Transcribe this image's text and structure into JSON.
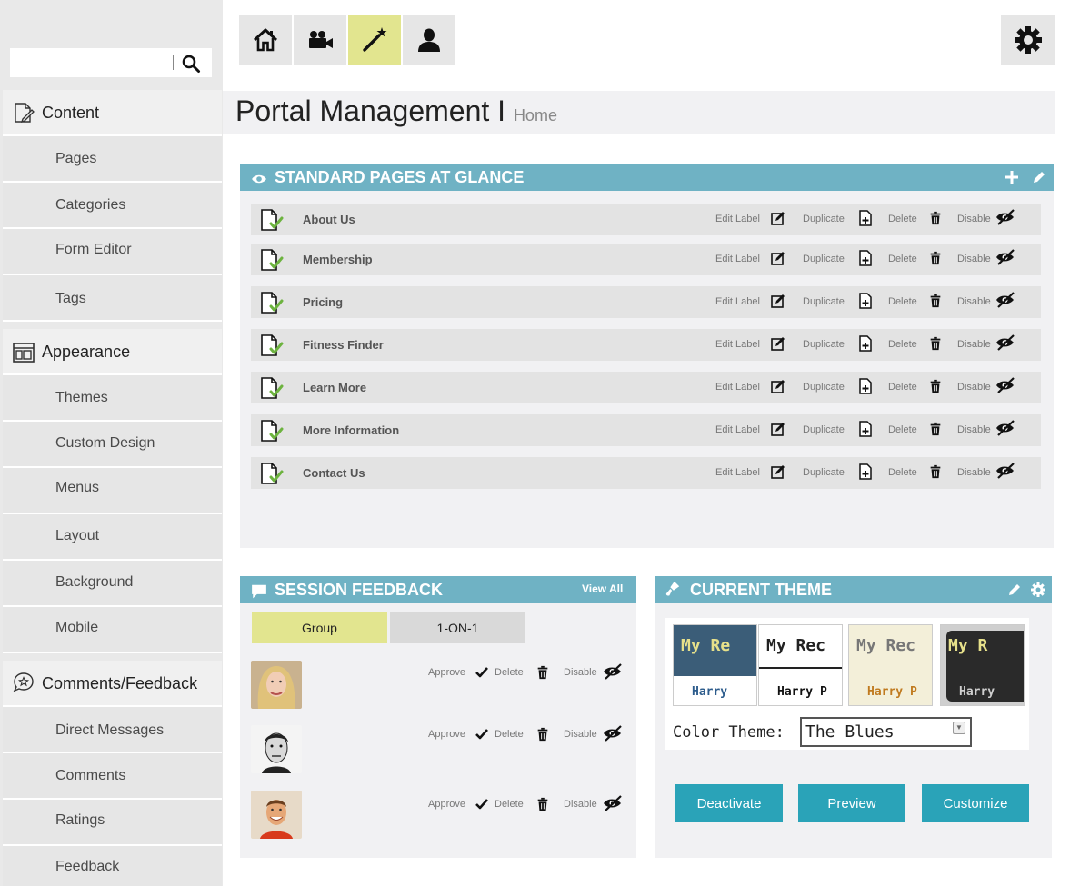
{
  "sidebar": {
    "search_placeholder": "",
    "sections": [
      {
        "label": "Content",
        "icon": "document-edit-icon",
        "items": [
          {
            "label": "Pages"
          },
          {
            "label": "Categories"
          },
          {
            "label": "Form Editor"
          },
          {
            "label": "Tags"
          }
        ]
      },
      {
        "label": "Appearance",
        "icon": "layout-icon",
        "items": [
          {
            "label": "Themes"
          },
          {
            "label": "Custom Design"
          },
          {
            "label": "Menus"
          },
          {
            "label": "Layout"
          },
          {
            "label": "Background"
          },
          {
            "label": "Mobile"
          }
        ]
      },
      {
        "label": "Comments/Feedback",
        "icon": "comment-star-icon",
        "items": [
          {
            "label": "Direct Messages"
          },
          {
            "label": "Comments"
          },
          {
            "label": "Ratings"
          },
          {
            "label": "Feedback"
          }
        ]
      }
    ]
  },
  "toolbar": {
    "buttons": [
      {
        "icon": "home-icon"
      },
      {
        "icon": "video-camera-icon"
      },
      {
        "icon": "magic-wand-icon",
        "active": true
      },
      {
        "icon": "user-icon"
      }
    ],
    "settings_icon": "gear-icon",
    "active_color": "#e2e58f"
  },
  "header": {
    "title": "Portal Management I",
    "subtitle": "Home"
  },
  "standard_pages": {
    "title": "STANDARD PAGES AT GLANCE",
    "actions": {
      "edit": "Edit Label",
      "duplicate": "Duplicate",
      "delete": "Delete",
      "disable": "Disable"
    },
    "rows": [
      {
        "name": "About Us"
      },
      {
        "name": "Membership"
      },
      {
        "name": "Pricing"
      },
      {
        "name": "Fitness Finder"
      },
      {
        "name": "Learn More"
      },
      {
        "name": "More Information"
      },
      {
        "name": "Contact Us"
      }
    ]
  },
  "feedback": {
    "title": "SESSION FEEDBACK",
    "view_all": "View All",
    "tabs": [
      {
        "label": "Group",
        "active": true
      },
      {
        "label": "1-ON-1",
        "active": false
      }
    ],
    "actions": {
      "approve": "Approve",
      "delete": "Delete",
      "disable": "Disable"
    },
    "entries": [
      {
        "avatar": "woman-avatar"
      },
      {
        "avatar": "man-avatar-bw"
      },
      {
        "avatar": "man-avatar-smiling"
      }
    ]
  },
  "theme": {
    "title": "CURRENT THEME",
    "thumbs": [
      {
        "heading": "My Re",
        "sub": "Harry",
        "bg": "#3b5d78",
        "fg": "#e6e08a"
      },
      {
        "heading": "My Rec",
        "sub": "Harry P",
        "bg": "#ffffff",
        "fg": "#222222"
      },
      {
        "heading": "My Rec",
        "sub": "Harry P",
        "bg": "#f3efd9",
        "fg": "#777777"
      },
      {
        "heading": "My R",
        "sub": "Harry",
        "bg": "#2a2a2a",
        "fg": "#e6e08a"
      }
    ],
    "color_label": "Color Theme:",
    "color_value": "The Blues",
    "buttons": [
      {
        "label": "Deactivate"
      },
      {
        "label": "Preview"
      },
      {
        "label": "Customize"
      }
    ]
  },
  "colors": {
    "accent": "#6fb2c4",
    "button": "#2aa3b8",
    "sidebar": "#e6e6e6"
  }
}
